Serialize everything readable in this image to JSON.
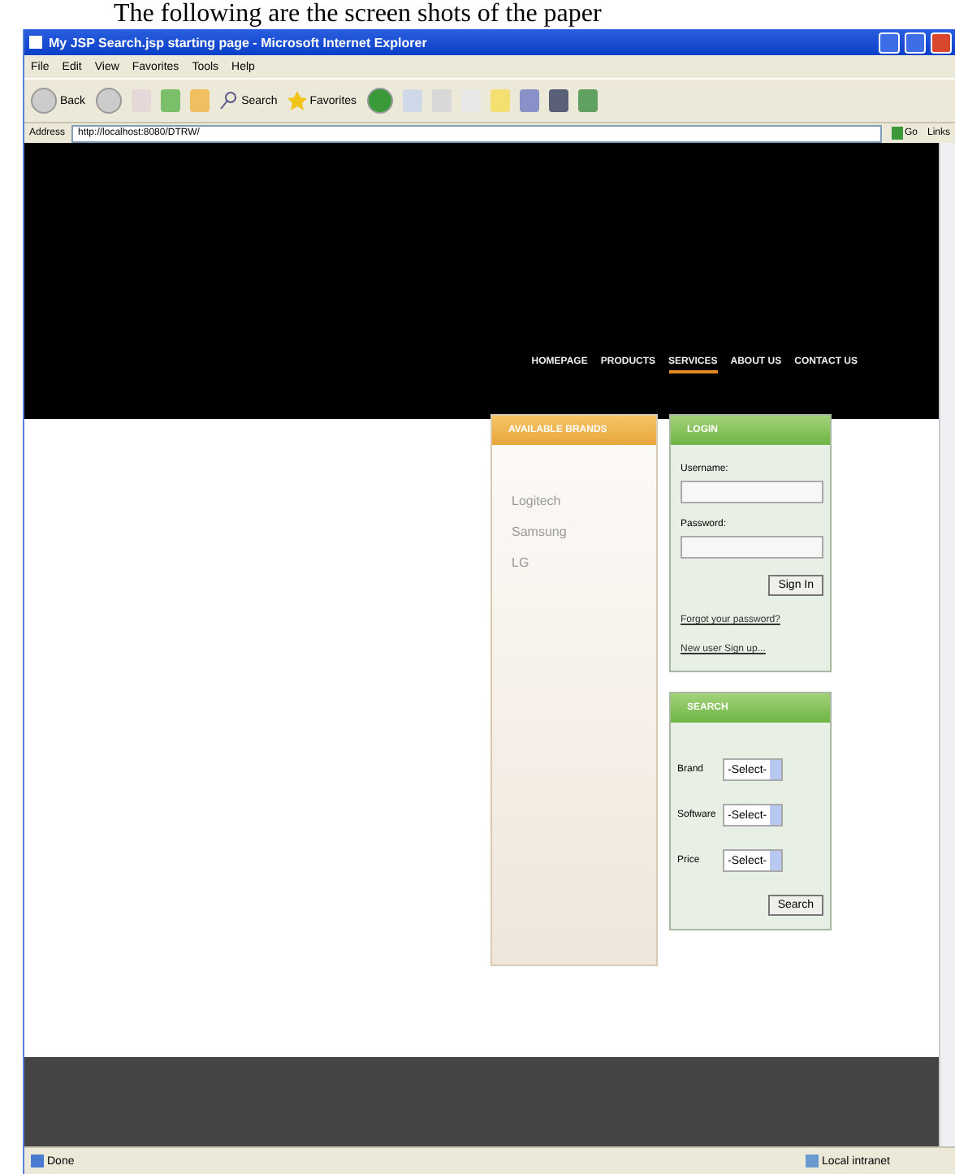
{
  "caption": "The following are the screen shots of the paper",
  "window": {
    "title": "My JSP Search.jsp starting page - Microsoft Internet Explorer"
  },
  "menu": [
    "File",
    "Edit",
    "View",
    "Favorites",
    "Tools",
    "Help"
  ],
  "toolbar": {
    "back": "Back",
    "search": "Search",
    "favorites": "Favorites"
  },
  "address": {
    "label": "Address",
    "url": "http://localhost:8080/DTRW/",
    "go": "Go",
    "links": "Links"
  },
  "nav": [
    {
      "label": "HOMEPAGE",
      "selected": false
    },
    {
      "label": "PRODUCTS",
      "selected": false
    },
    {
      "label": "SERVICES",
      "selected": true
    },
    {
      "label": "ABOUT US",
      "selected": false
    },
    {
      "label": "CONTACT US",
      "selected": false
    }
  ],
  "brands": {
    "title": "AVAILABLE BRANDS",
    "items": [
      "Logitech",
      "Samsung",
      "LG"
    ]
  },
  "login": {
    "title": "LOGIN",
    "username_label": "Username:",
    "password_label": "Password:",
    "button": "Sign In",
    "links": [
      "Forgot your password?",
      "New user Sign up..."
    ]
  },
  "search": {
    "title": "SEARCH",
    "fields": [
      {
        "label": "Brand",
        "value": "-Select-"
      },
      {
        "label": "Software",
        "value": "-Select-"
      },
      {
        "label": "Price",
        "value": "-Select-"
      }
    ],
    "button": "Search"
  },
  "status_bar": {
    "left": "Done",
    "right": "Local intranet"
  }
}
